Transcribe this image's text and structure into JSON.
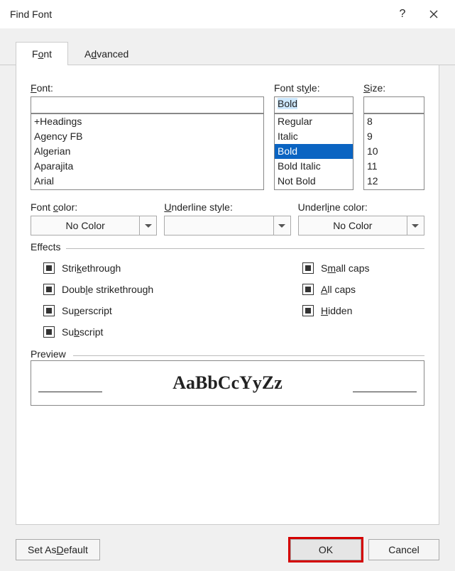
{
  "titlebar": {
    "title": "Find Font",
    "help": "?",
    "close": "✕"
  },
  "tabs": {
    "font_pre": "F",
    "font_u": "o",
    "font_post": "nt",
    "adv_pre": "A",
    "adv_u": "d",
    "adv_post": "vanced"
  },
  "labels": {
    "font_pre": "",
    "font_u": "F",
    "font_post": "ont:",
    "style": "Font st",
    "style_u": "y",
    "style_post": "le:",
    "size_pre": "",
    "size_u": "S",
    "size_post": "ize:",
    "fcolor": "Font ",
    "fcolor_u": "c",
    "fcolor_post": "olor:",
    "uline_pre": "",
    "uline_u": "U",
    "uline_post": "nderline style:",
    "ucolor_pre": "Underl",
    "ucolor_u": "i",
    "ucolor_post": "ne color:"
  },
  "font_input": "",
  "style_input": "Bold",
  "size_input": "",
  "fonts": [
    "+Headings",
    "Agency FB",
    "Algerian",
    "Aparajita",
    "Arial"
  ],
  "styles": [
    "Regular",
    "Italic",
    "Bold",
    "Bold Italic",
    "Not Bold"
  ],
  "style_selected": "Bold",
  "sizes": [
    "8",
    "9",
    "10",
    "11",
    "12"
  ],
  "dropdowns": {
    "font_color": "No Color",
    "underline_style": "",
    "underline_color": "No Color"
  },
  "effects_label": "Effects",
  "effects_left": [
    {
      "pre": "Stri",
      "u": "k",
      "post": "ethrough"
    },
    {
      "pre": "Doub",
      "u": "l",
      "post": "e strikethrough"
    },
    {
      "pre": "Su",
      "u": "p",
      "post": "erscript"
    },
    {
      "pre": "Su",
      "u": "b",
      "post": "script"
    }
  ],
  "effects_right": [
    {
      "pre": "S",
      "u": "m",
      "post": "all caps"
    },
    {
      "pre": "",
      "u": "A",
      "post": "ll caps"
    },
    {
      "pre": "",
      "u": "H",
      "post": "idden"
    }
  ],
  "preview": {
    "label": "Preview",
    "text": "AaBbCcYyZz"
  },
  "buttons": {
    "default_pre": "Set As ",
    "default_u": "D",
    "default_post": "efault",
    "ok": "OK",
    "cancel": "Cancel"
  }
}
